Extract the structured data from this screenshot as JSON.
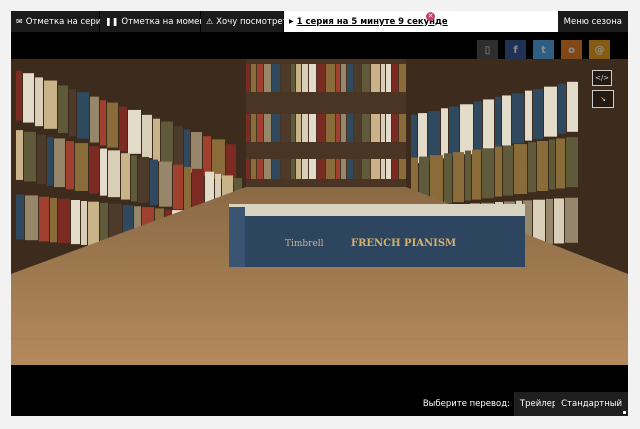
{
  "tabs": [
    {
      "label": "Отметка на серии",
      "icon": "envelope-icon"
    },
    {
      "label": "Отметка на моменте",
      "icon": "pause-icon"
    },
    {
      "label": "Хочу посмотреть",
      "icon": "warning-icon"
    }
  ],
  "progress": {
    "label": "1 серия на 5 минуте 9 секунде"
  },
  "season_menu": {
    "label": "Меню сезона"
  },
  "social": [
    {
      "icon": "bookmark-icon",
      "glyph": "▯",
      "color": "#555555"
    },
    {
      "icon": "facebook-icon",
      "glyph": "f",
      "color": "#3b5998"
    },
    {
      "icon": "twitter-icon",
      "glyph": "t",
      "color": "#55acee"
    },
    {
      "icon": "odnoklassniki-icon",
      "glyph": "o",
      "color": "#ed812b"
    },
    {
      "icon": "mailru-icon",
      "glyph": "@",
      "color": "#f5a623"
    }
  ],
  "video": {
    "book_title": "FRENCH PIANISM",
    "book_author": "Timbrell"
  },
  "side_controls": [
    {
      "icon": "embed-code-icon",
      "glyph": "</>"
    },
    {
      "icon": "fullscreen-exit-icon",
      "glyph": "↘"
    }
  ],
  "translation": {
    "label": "Выберите перевод:",
    "options": [
      "Трейлеры",
      "Стандартный"
    ]
  }
}
